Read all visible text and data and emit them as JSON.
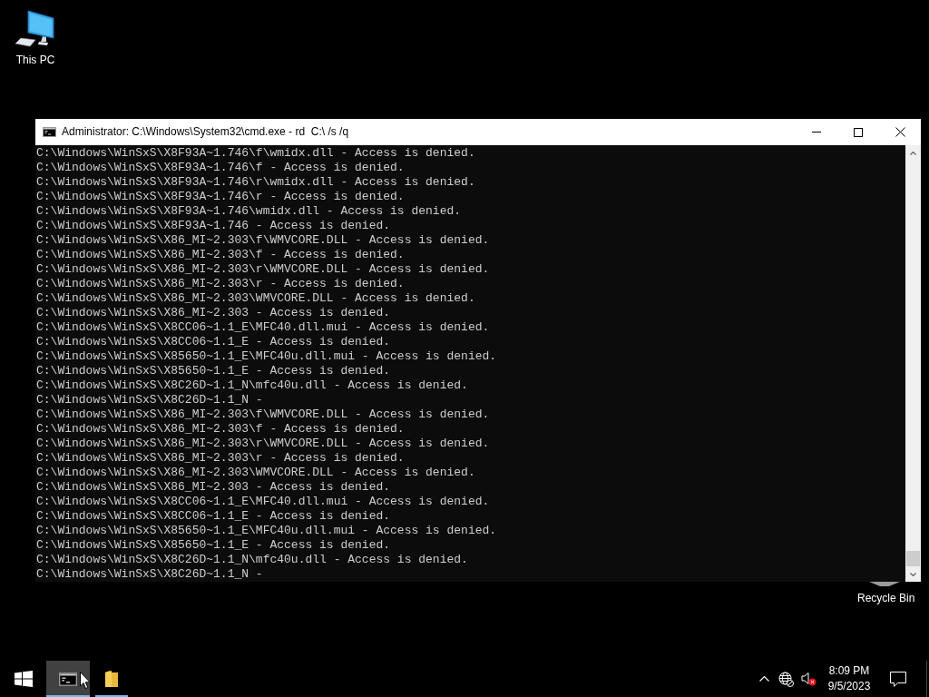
{
  "desktop": {
    "this_pc": {
      "label": "This PC"
    },
    "recycle_bin": {
      "label": "Recycle Bin"
    }
  },
  "window": {
    "title": "Administrator: C:\\Windows\\System32\\cmd.exe - rd  C:\\ /s /q",
    "lines": [
      "C:\\Windows\\WinSxS\\X8F93A~1.746\\f\\wmidx.dll - Access is denied.",
      "C:\\Windows\\WinSxS\\X8F93A~1.746\\f - Access is denied.",
      "C:\\Windows\\WinSxS\\X8F93A~1.746\\r\\wmidx.dll - Access is denied.",
      "C:\\Windows\\WinSxS\\X8F93A~1.746\\r - Access is denied.",
      "C:\\Windows\\WinSxS\\X8F93A~1.746\\wmidx.dll - Access is denied.",
      "C:\\Windows\\WinSxS\\X8F93A~1.746 - Access is denied.",
      "C:\\Windows\\WinSxS\\X86_MI~2.303\\f\\WMVCORE.DLL - Access is denied.",
      "C:\\Windows\\WinSxS\\X86_MI~2.303\\f - Access is denied.",
      "C:\\Windows\\WinSxS\\X86_MI~2.303\\r\\WMVCORE.DLL - Access is denied.",
      "C:\\Windows\\WinSxS\\X86_MI~2.303\\r - Access is denied.",
      "C:\\Windows\\WinSxS\\X86_MI~2.303\\WMVCORE.DLL - Access is denied.",
      "C:\\Windows\\WinSxS\\X86_MI~2.303 - Access is denied.",
      "C:\\Windows\\WinSxS\\X8CC06~1.1_E\\MFC40.dll.mui - Access is denied.",
      "C:\\Windows\\WinSxS\\X8CC06~1.1_E - Access is denied.",
      "C:\\Windows\\WinSxS\\X85650~1.1_E\\MFC40u.dll.mui - Access is denied.",
      "C:\\Windows\\WinSxS\\X85650~1.1_E - Access is denied.",
      "C:\\Windows\\WinSxS\\X8C26D~1.1_N\\mfc40u.dll - Access is denied.",
      "C:\\Windows\\WinSxS\\X8C26D~1.1_N -",
      "C:\\Windows\\WinSxS\\X86_MI~2.303\\f\\WMVCORE.DLL - Access is denied.",
      "C:\\Windows\\WinSxS\\X86_MI~2.303\\f - Access is denied.",
      "C:\\Windows\\WinSxS\\X86_MI~2.303\\r\\WMVCORE.DLL - Access is denied.",
      "C:\\Windows\\WinSxS\\X86_MI~2.303\\r - Access is denied.",
      "C:\\Windows\\WinSxS\\X86_MI~2.303\\WMVCORE.DLL - Access is denied.",
      "C:\\Windows\\WinSxS\\X86_MI~2.303 - Access is denied.",
      "C:\\Windows\\WinSxS\\X8CC06~1.1_E\\MFC40.dll.mui - Access is denied.",
      "C:\\Windows\\WinSxS\\X8CC06~1.1_E - Access is denied.",
      "C:\\Windows\\WinSxS\\X85650~1.1_E\\MFC40u.dll.mui - Access is denied.",
      "C:\\Windows\\WinSxS\\X85650~1.1_E - Access is denied.",
      "C:\\Windows\\WinSxS\\X8C26D~1.1_N\\mfc40u.dll - Access is denied.",
      "C:\\Windows\\WinSxS\\X8C26D~1.1_N -"
    ]
  },
  "taskbar": {
    "apps": [
      {
        "kind": "console",
        "selected": true,
        "running": true
      },
      {
        "kind": "folder",
        "selected": false,
        "running": true
      }
    ],
    "tray": {
      "volume_muted": true
    },
    "clock": {
      "time": "8:09 PM",
      "date": "9/5/2023"
    }
  }
}
